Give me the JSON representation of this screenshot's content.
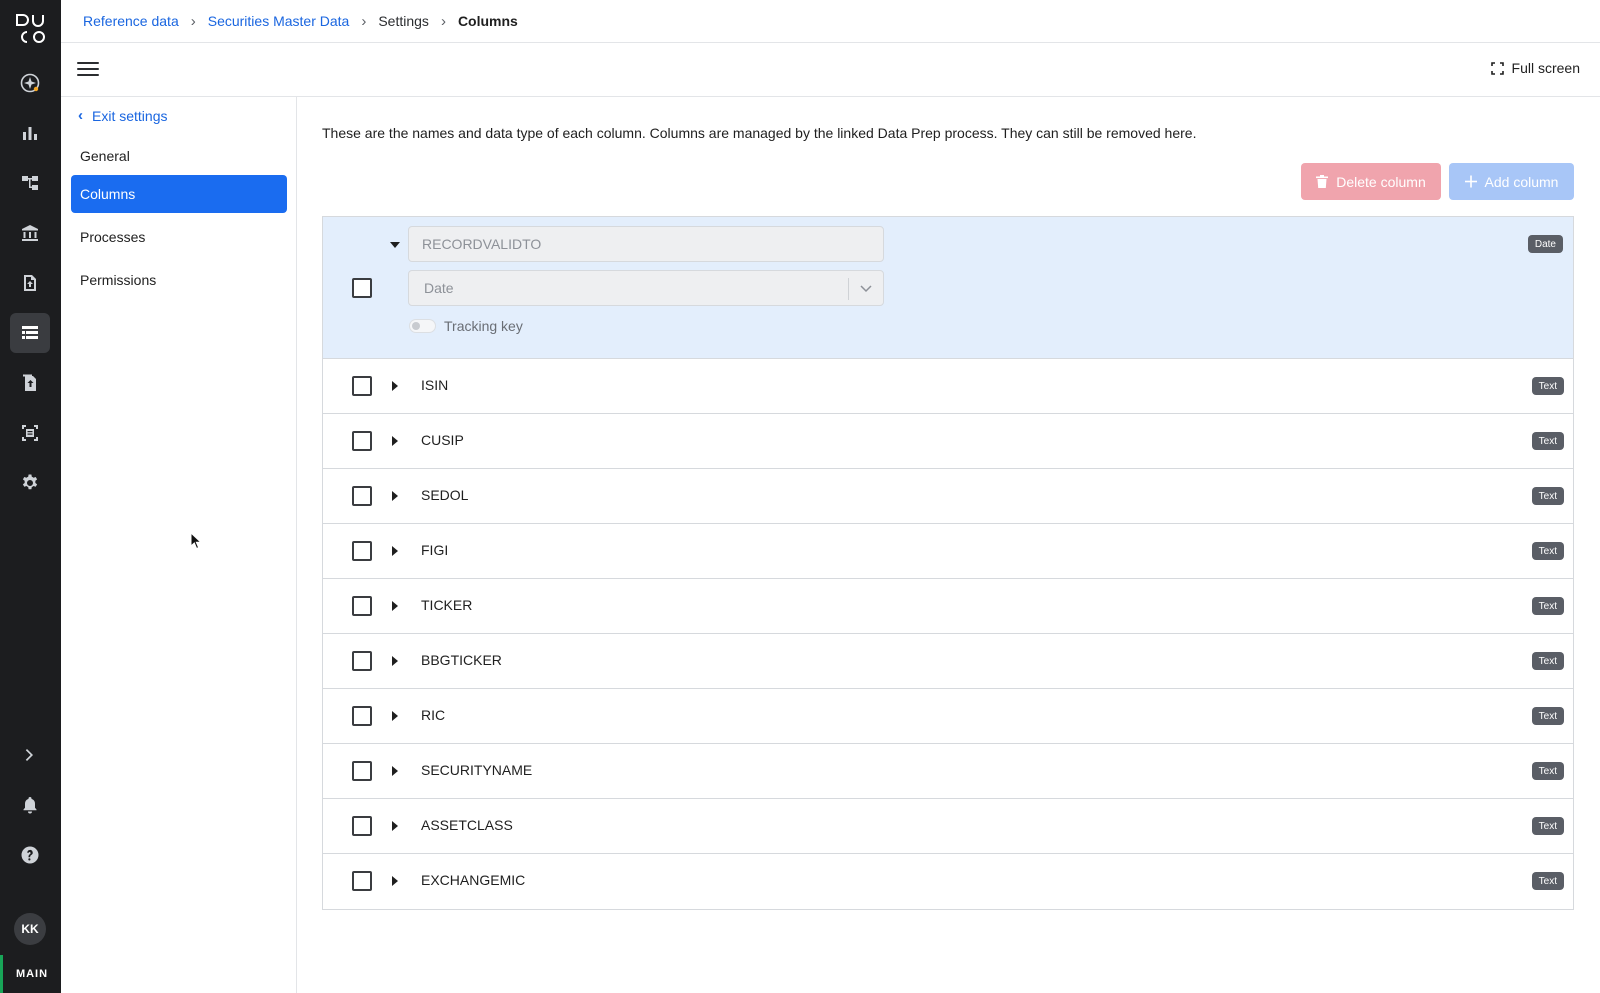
{
  "app": {
    "logo": "DUCO",
    "user_initials": "KK",
    "environment": "MAIN"
  },
  "breadcrumb": [
    {
      "label": "Reference data",
      "link": true
    },
    {
      "label": "Securities Master Data",
      "link": true
    },
    {
      "label": "Settings",
      "link": false
    },
    {
      "label": "Columns",
      "current": true
    }
  ],
  "toolbar": {
    "fullscreen_label": "Full screen"
  },
  "settings_nav": {
    "exit_label": "Exit settings",
    "items": [
      {
        "label": "General",
        "active": false
      },
      {
        "label": "Columns",
        "active": true
      },
      {
        "label": "Processes",
        "active": false
      },
      {
        "label": "Permissions",
        "active": false
      }
    ]
  },
  "main": {
    "description": "These are the names and data type of each column. Columns are managed by the linked Data Prep process. They can still be removed here.",
    "delete_button": "Delete column",
    "add_button": "Add column",
    "expanded_column": {
      "name": "RECORDVALIDTO",
      "type": "Date",
      "badge": "Date",
      "tracking_key_label": "Tracking key",
      "tracking_key_on": false
    },
    "columns": [
      {
        "name": "ISIN",
        "type": "Text"
      },
      {
        "name": "CUSIP",
        "type": "Text"
      },
      {
        "name": "SEDOL",
        "type": "Text"
      },
      {
        "name": "FIGI",
        "type": "Text"
      },
      {
        "name": "TICKER",
        "type": "Text"
      },
      {
        "name": "BBGTICKER",
        "type": "Text"
      },
      {
        "name": "RIC",
        "type": "Text"
      },
      {
        "name": "SECURITYNAME",
        "type": "Text"
      },
      {
        "name": "ASSETCLASS",
        "type": "Text"
      },
      {
        "name": "EXCHANGEMIC",
        "type": "Text"
      }
    ]
  },
  "colors": {
    "accent": "#1a6cf0",
    "rail": "#1c1d1f",
    "delete": "#f0a4ad",
    "add": "#a8c6f7",
    "expanded_row": "#e3eefc"
  }
}
